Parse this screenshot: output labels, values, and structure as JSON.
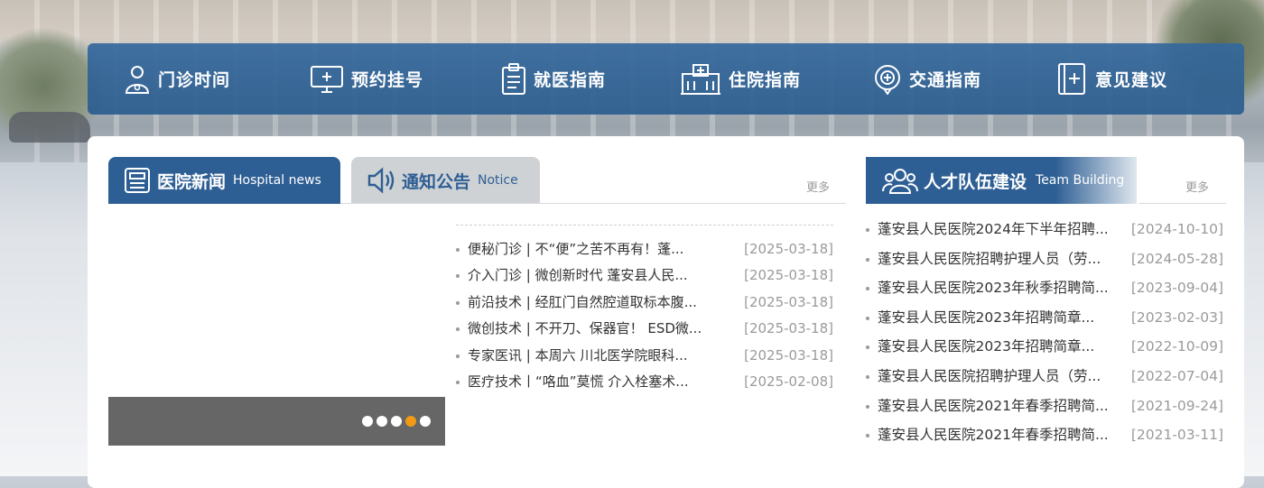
{
  "nav": {
    "items": [
      {
        "label": "门诊时间",
        "icon": "doctor-icon"
      },
      {
        "label": "预约挂号",
        "icon": "monitor-icon"
      },
      {
        "label": "就医指南",
        "icon": "clipboard-icon"
      },
      {
        "label": "住院指南",
        "icon": "hospital-icon"
      },
      {
        "label": "交通指南",
        "icon": "location-pin-icon"
      },
      {
        "label": "意见建议",
        "icon": "feedback-icon"
      }
    ]
  },
  "news_section": {
    "tabs": [
      {
        "label": "医院新闻",
        "en": "Hospital news",
        "active": true,
        "icon": "newspaper-icon"
      },
      {
        "label": "通知公告",
        "en": "Notice",
        "active": false,
        "icon": "speaker-icon"
      }
    ],
    "more_label": "更多",
    "slider": {
      "dot_count": 5,
      "active_dot": 4
    },
    "items": [
      {
        "title": "便秘门诊 | 不“便”之苦不再有！蓬...",
        "date": "[2025-03-18]"
      },
      {
        "title": "介入门诊 | 微创新时代 蓬安县人民...",
        "date": "[2025-03-18]"
      },
      {
        "title": "前沿技术 | 经肛门自然腔道取标本腹...",
        "date": "[2025-03-18]"
      },
      {
        "title": "微创技术 | 不开刀、保器官！ ESD微...",
        "date": "[2025-03-18]"
      },
      {
        "title": "专家医讯 | 本周六 川北医学院眼科...",
        "date": "[2025-03-18]"
      },
      {
        "title": "医疗技术丨“咯血”莫慌 介入栓塞术...",
        "date": "[2025-02-08]"
      }
    ]
  },
  "team_section": {
    "label": "人才队伍建设",
    "en": "Team Building",
    "icon": "team-icon",
    "more_label": "更多",
    "items": [
      {
        "title": "蓬安县人民医院2024年下半年招聘...",
        "date": "[2024-10-10]"
      },
      {
        "title": "蓬安县人民医院招聘护理人员（劳...",
        "date": "[2024-05-28]"
      },
      {
        "title": "蓬安县人民医院2023年秋季招聘简...",
        "date": "[2023-09-04]"
      },
      {
        "title": "蓬安县人民医院2023年招聘简章...",
        "date": "[2023-02-03]"
      },
      {
        "title": "蓬安县人民医院2023年招聘简章...",
        "date": "[2022-10-09]"
      },
      {
        "title": "蓬安县人民医院招聘护理人员（劳...",
        "date": "[2022-07-04]"
      },
      {
        "title": "蓬安县人民医院2021年春季招聘简...",
        "date": "[2021-09-24]"
      },
      {
        "title": "蓬安县人民医院2021年春季招聘简...",
        "date": "[2021-03-11]"
      }
    ]
  },
  "colors": {
    "primary": "#2e5f94",
    "nav_bg": "#34689c",
    "accent_dot": "#f29a16",
    "muted_text": "#9a9a9a"
  }
}
